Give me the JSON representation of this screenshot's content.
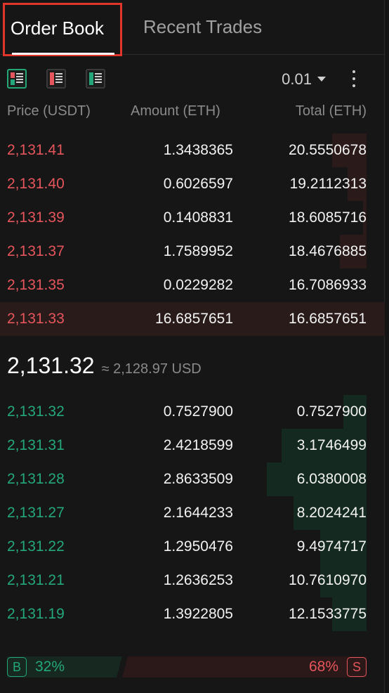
{
  "tabs": {
    "order_book": "Order Book",
    "recent_trades": "Recent Trades"
  },
  "toolbar": {
    "views": [
      {
        "icon": "order-book-both-icon",
        "active": true
      },
      {
        "icon": "order-book-asks-icon",
        "active": false
      },
      {
        "icon": "order-book-bids-icon",
        "active": false
      }
    ],
    "precision": "0.01",
    "more_icon": "more-vertical-icon"
  },
  "columns": {
    "price": "Price (USDT)",
    "amount": "Amount (ETH)",
    "total": "Total (ETH)"
  },
  "asks": [
    {
      "price": "2,131.41",
      "amount": "1.3438365",
      "total": "20.5550678",
      "depth_pct": 9
    },
    {
      "price": "2,131.40",
      "amount": "0.6026597",
      "total": "19.2112313",
      "depth_pct": 5
    },
    {
      "price": "2,131.39",
      "amount": "0.1408831",
      "total": "18.6085716",
      "depth_pct": 1
    },
    {
      "price": "2,131.37",
      "amount": "1.7589952",
      "total": "18.4676885",
      "depth_pct": 7
    },
    {
      "price": "2,131.35",
      "amount": "0.0229282",
      "total": "16.7086933",
      "depth_pct": 0
    },
    {
      "price": "2,131.33",
      "amount": "16.6857651",
      "total": "16.6857651",
      "depth_pct": 0
    }
  ],
  "mid": {
    "last_price": "2,131.32",
    "approx_usd": "≈ 2,128.97 USD"
  },
  "bids": [
    {
      "price": "2,131.32",
      "amount": "0.7527900",
      "total": "0.7527900",
      "depth_pct": 6
    },
    {
      "price": "2,131.31",
      "amount": "2.4218599",
      "total": "3.1746499",
      "depth_pct": 22
    },
    {
      "price": "2,131.28",
      "amount": "2.8633509",
      "total": "6.0380008",
      "depth_pct": 26
    },
    {
      "price": "2,131.27",
      "amount": "2.1644233",
      "total": "8.2024241",
      "depth_pct": 19
    },
    {
      "price": "2,131.22",
      "amount": "1.2950476",
      "total": "9.4974717",
      "depth_pct": 12
    },
    {
      "price": "2,131.21",
      "amount": "1.2636253",
      "total": "10.7610970",
      "depth_pct": 12
    },
    {
      "price": "2,131.19",
      "amount": "1.3922805",
      "total": "12.1533775",
      "depth_pct": 9
    }
  ],
  "ratio": {
    "buy_label": "B",
    "buy_pct": "32%",
    "buy_value": 32,
    "sell_label": "S",
    "sell_pct": "68%",
    "sell_value": 68
  },
  "colors": {
    "ask": "#e5555c",
    "bid": "#24a77a",
    "highlight_border": "#e0352a"
  }
}
